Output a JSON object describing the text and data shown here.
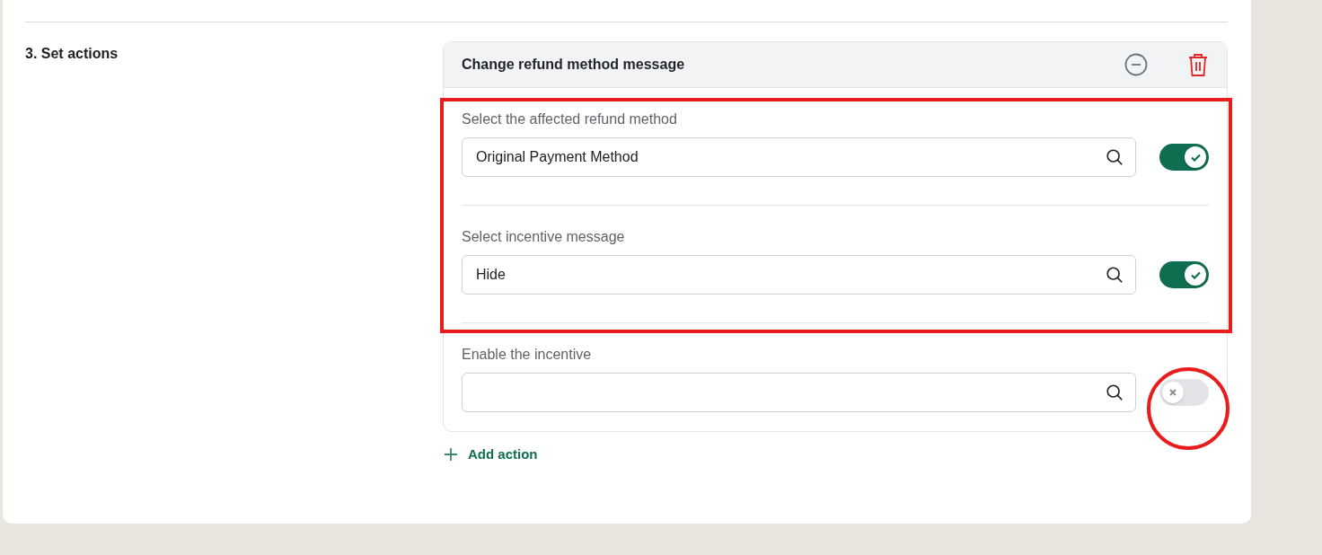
{
  "section": {
    "title": "3. Set actions"
  },
  "action": {
    "title": "Change refund method message",
    "fields": [
      {
        "label": "Select the affected refund method",
        "value": "Original Payment Method",
        "enabled": true,
        "highlighted": true
      },
      {
        "label": "Select incentive message",
        "value": "Hide",
        "enabled": true,
        "highlighted": true
      },
      {
        "label": "Enable the incentive",
        "enabled": false,
        "circled": true
      }
    ]
  },
  "add_action": {
    "label": "Add action"
  }
}
